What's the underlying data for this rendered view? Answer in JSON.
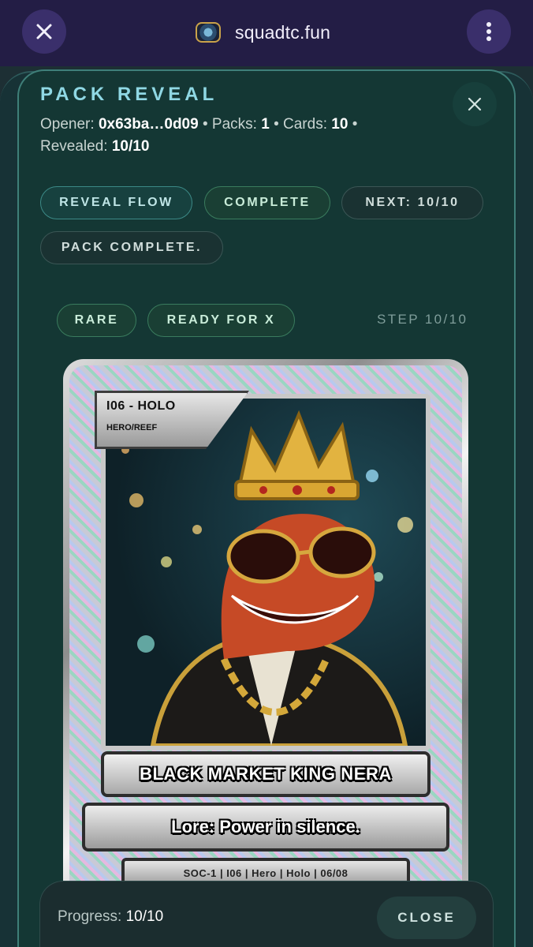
{
  "browser": {
    "site_name": "squadtc.fun",
    "close_icon": "close-icon",
    "menu_icon": "more-vertical-icon"
  },
  "panel": {
    "title": "PACK REVEAL",
    "meta": {
      "opener_label": "Opener:",
      "opener_value": "0x63ba…0d09",
      "packs_label": "Packs:",
      "packs_value": "1",
      "cards_label": "Cards:",
      "cards_value": "10",
      "revealed_label": "Revealed:",
      "revealed_value": "10/10",
      "separator": "•"
    },
    "tags": [
      "REVEAL FLOW",
      "COMPLETE",
      "NEXT: 10/10",
      "PACK COMPLETE."
    ],
    "card_badges": [
      "RARE",
      "READY FOR X"
    ],
    "step": "STEP 10/10"
  },
  "card": {
    "id_line": "I06 - HOLO",
    "type_line": "HERO/REEF",
    "name": "BLACK MARKET KING NERA",
    "lore": "Lore: Power in silence.",
    "footer": "SOC-1 | I06 | Hero | Holo | 06/08"
  },
  "progress": {
    "label": "Progress:",
    "value": "10/10",
    "close_label": "CLOSE"
  },
  "colors": {
    "accent": "#8fd8e4",
    "panel_bg": "#143734",
    "topbar_bg": "#231d45"
  }
}
